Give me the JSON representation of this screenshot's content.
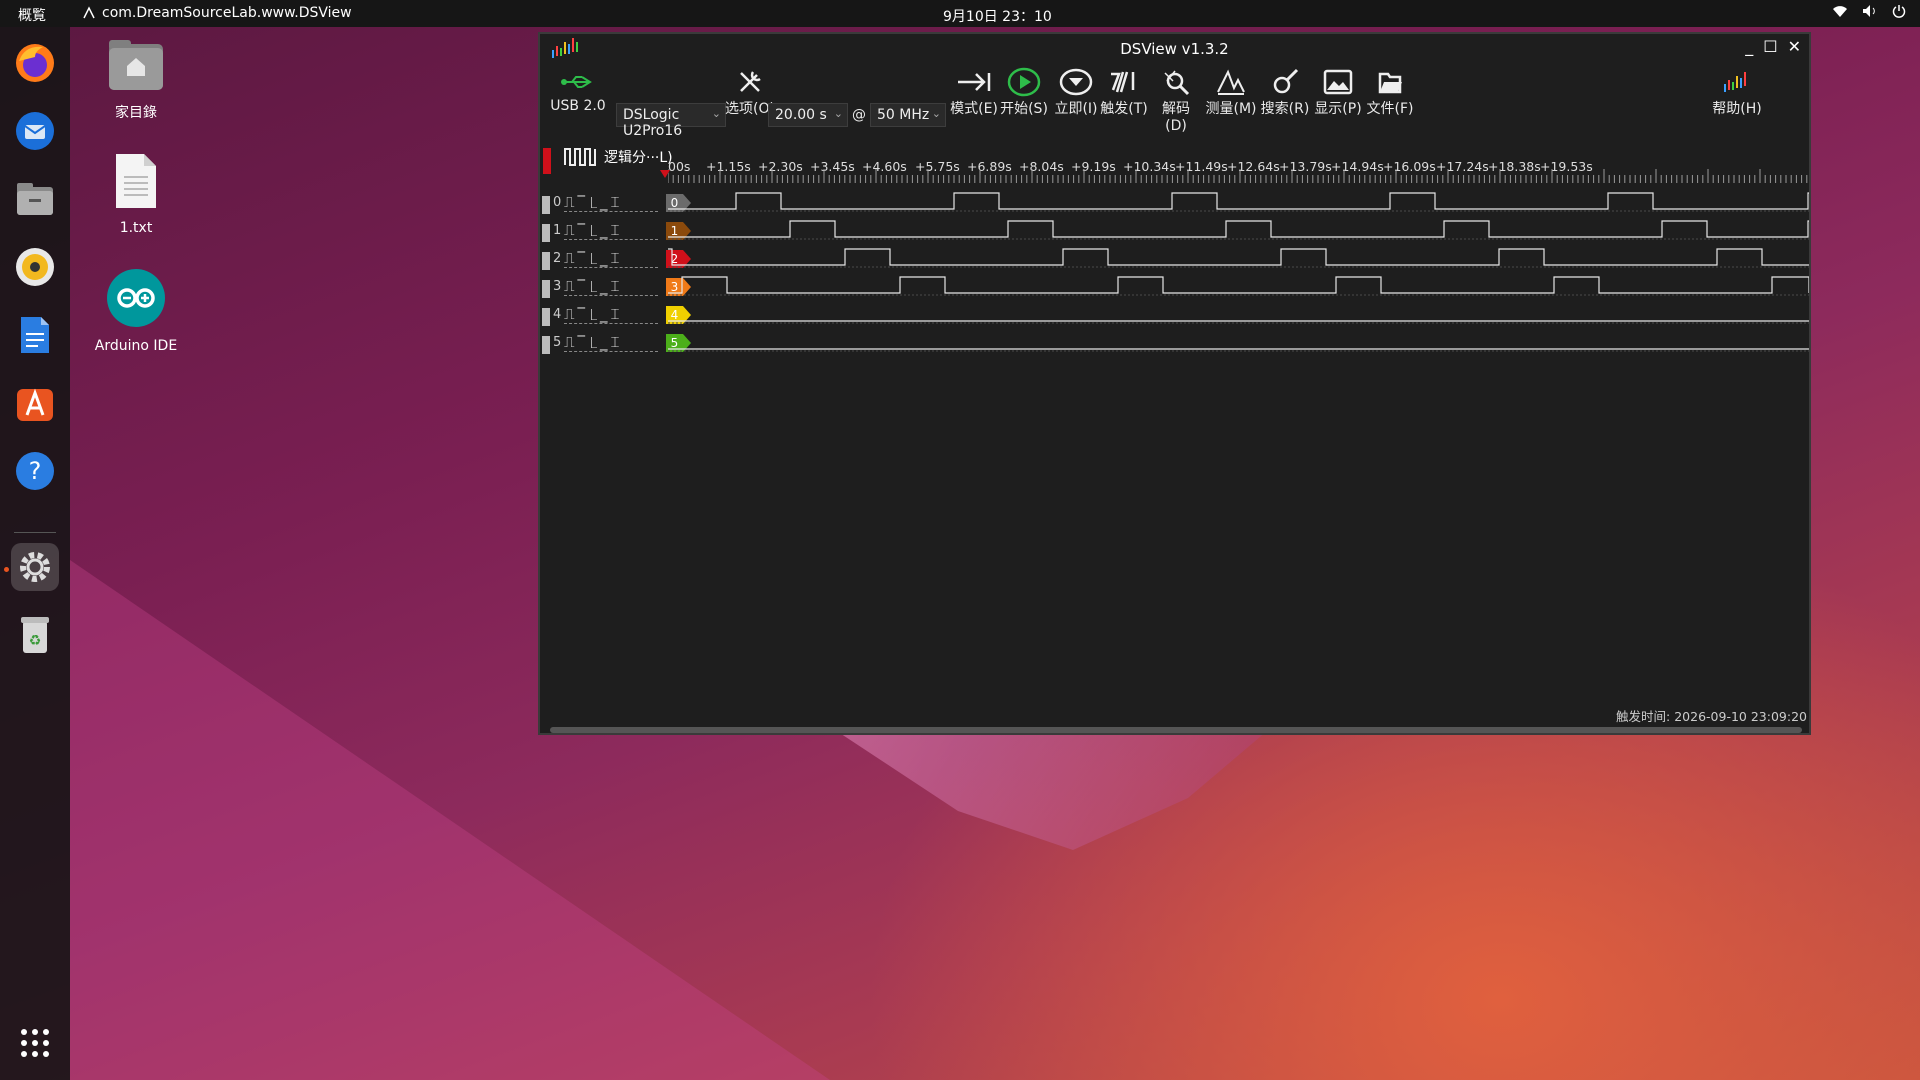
{
  "topbar": {
    "overview": "概覧",
    "app_name": "com.DreamSourceLab.www.DSView",
    "clock": "9月10日 23：10"
  },
  "dock": {
    "items": [
      "firefox-icon",
      "thunderbird-icon",
      "files-icon",
      "rhythmbox-icon",
      "writer-icon",
      "app-center-icon",
      "help-icon",
      "settings-icon",
      "trash-icon"
    ],
    "apps_grid_icon": "apps-grid-icon"
  },
  "desktop": {
    "icons": [
      {
        "label": "家目錄",
        "icon": "home-folder-icon"
      },
      {
        "label": "1.txt",
        "icon": "text-file-icon"
      },
      {
        "label": "Arduino IDE",
        "icon": "arduino-icon"
      }
    ]
  },
  "window": {
    "title": "DSView v1.3.2",
    "toolbar": {
      "usb_label": "USB 2.0",
      "device": "DSLogic U2Pro16",
      "options": "选项(O)",
      "duration": "20.00 s",
      "at": "@",
      "rate": "50 MHz",
      "mode": "模式(E)",
      "start": "开始(S)",
      "instant": "立即(I)",
      "trigger": "触发(T)",
      "decode": "解码(D)",
      "measure": "测量(M)",
      "search": "搜索(R)",
      "display": "显示(P)",
      "file": "文件(F)",
      "help": "帮助(H)"
    },
    "group_label": "逻辑分···L)",
    "ruler_ticks": [
      "00s",
      "+1.15s",
      "+2.30s",
      "+3.45s",
      "+4.60s",
      "+5.75s",
      "+6.89s",
      "+8.04s",
      "+9.19s",
      "+10.34s",
      "+11.49s",
      "+12.64s",
      "+13.79s",
      "+14.94s",
      "+16.09s",
      "+17.24s",
      "+18.38s",
      "+19.53s"
    ],
    "trigger_glyphs": "⎍‾⎿_⌶",
    "channels": [
      {
        "num": "0",
        "tag": "0",
        "color": "#6b6b6b"
      },
      {
        "num": "1",
        "tag": "1",
        "color": "#8b4a0c"
      },
      {
        "num": "2",
        "tag": "2",
        "color": "#d0101a"
      },
      {
        "num": "3",
        "tag": "3",
        "color": "#f07a18"
      },
      {
        "num": "4",
        "tag": "4",
        "color": "#f0d000"
      },
      {
        "num": "5",
        "tag": "5",
        "color": "#4caf1a"
      }
    ],
    "trigger_time": "触发时间: 2026-09-10 23:09:20"
  }
}
